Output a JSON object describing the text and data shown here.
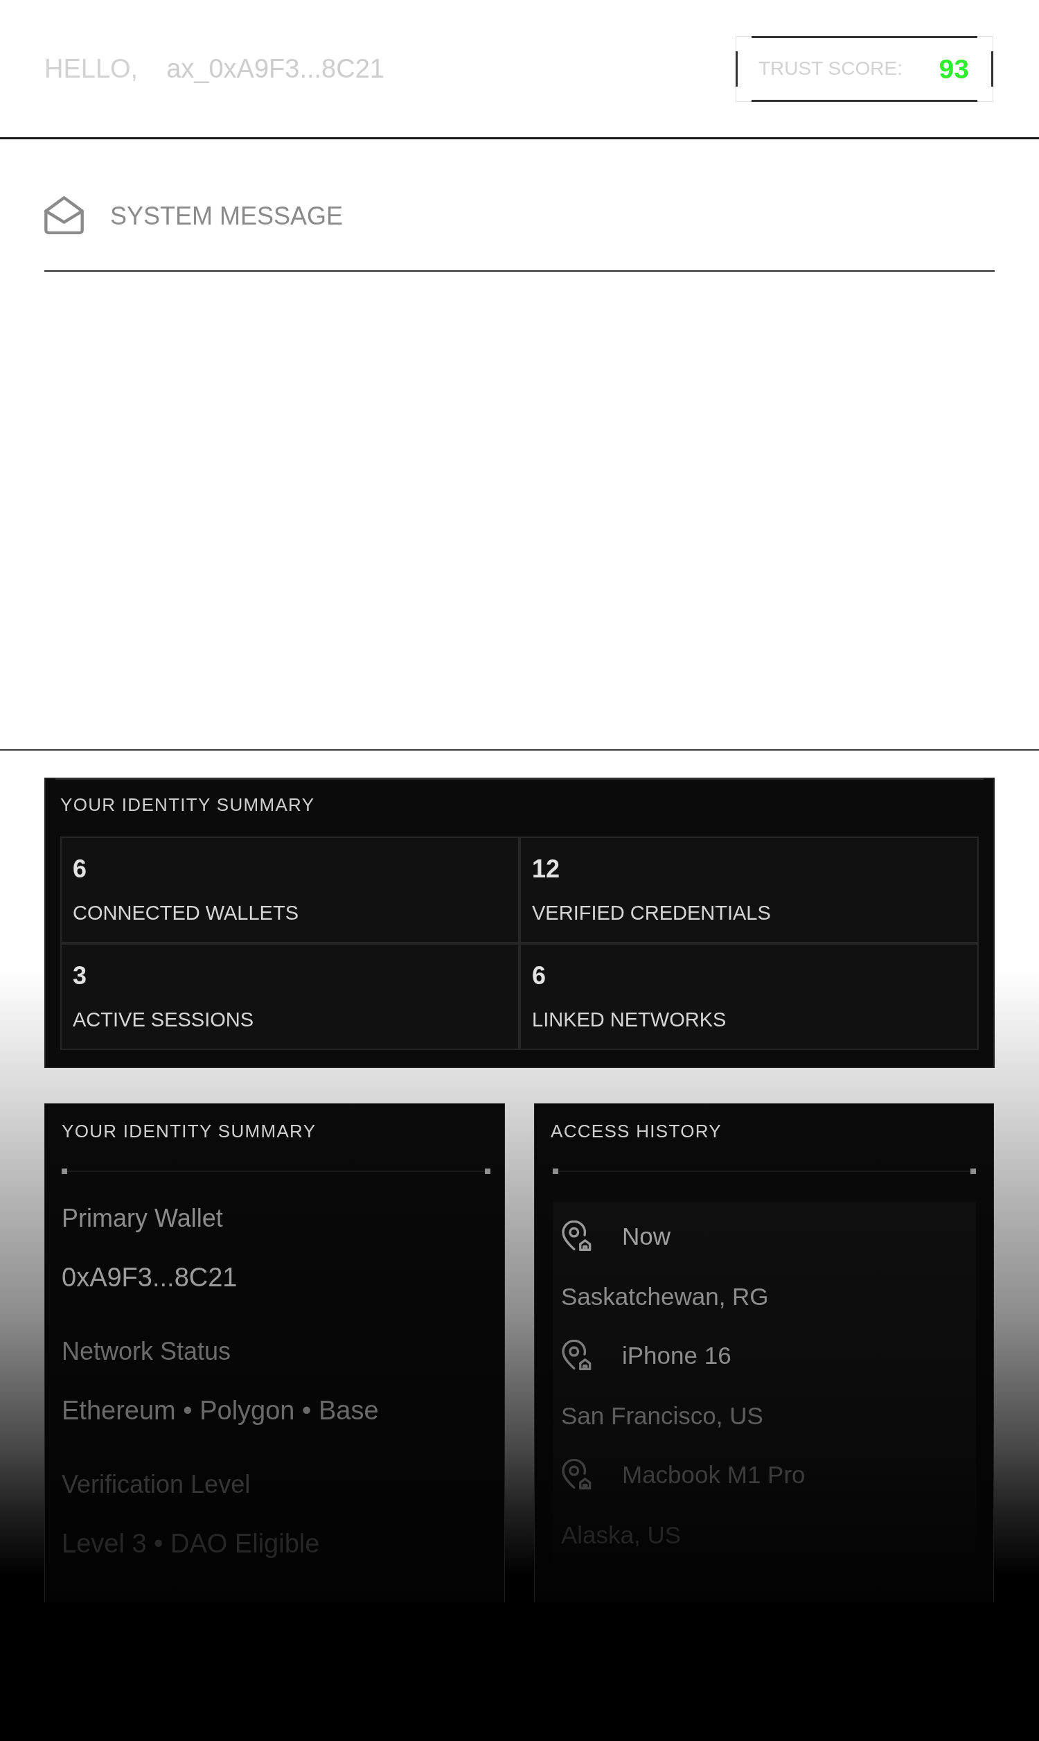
{
  "header": {
    "greeting": "HELLO,",
    "user_id": "ax_0xA9F3...8C21",
    "trust_score": {
      "label": "TRUST SCORE:",
      "value": "93"
    }
  },
  "system_message": {
    "title": "SYSTEM MESSAGE"
  },
  "identity_summary": {
    "title": "YOUR IDENTITY SUMMARY",
    "stats": [
      {
        "value": "6",
        "label": "CONNECTED WALLETS"
      },
      {
        "value": "12",
        "label": "VERIFIED CREDENTIALS"
      },
      {
        "value": "3",
        "label": "ACTIVE SESSIONS"
      },
      {
        "value": "6",
        "label": "LINKED NETWORKS"
      }
    ]
  },
  "identity_details": {
    "title": "YOUR IDENTITY SUMMARY",
    "fields": [
      {
        "label": "Primary Wallet",
        "value": "0xA9F3...8C21"
      },
      {
        "label": "Network Status",
        "value": "Ethereum • Polygon • Base"
      },
      {
        "label": "Verification Level",
        "value": "Level 3 • DAO Eligible"
      }
    ]
  },
  "access_history": {
    "title": "ACCESS HISTORY",
    "entries": [
      {
        "title": "Now",
        "location": "Saskatchewan, RG"
      },
      {
        "title": "iPhone 16",
        "location": "San Francisco, US"
      },
      {
        "title": "Macbook M1 Pro",
        "location": "Alaska, US"
      }
    ]
  }
}
